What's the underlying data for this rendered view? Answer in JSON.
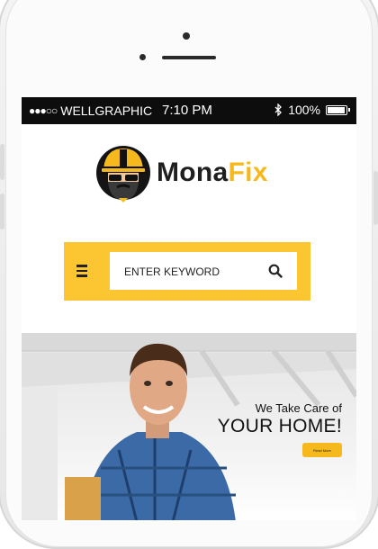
{
  "status_bar": {
    "signal": "●●●○○",
    "carrier": "WELLGRAPHIC",
    "time": "7:10 PM",
    "battery_pct": "100%",
    "battery_level": 1.0,
    "bluetooth_icon": "bluetooth-icon"
  },
  "logo": {
    "part1": "Mona",
    "part2": "Fix",
    "mascot_icon": "worker-mascot-icon"
  },
  "search": {
    "placeholder": "ENTER KEYWORD",
    "menu_icon": "hamburger-menu-icon",
    "search_icon": "search-icon"
  },
  "hero": {
    "line1": "We Take Care of",
    "line2": "YOUR HOME!",
    "button": "Read More"
  },
  "colors": {
    "accent": "#f6b91d",
    "bar": "#fbc631",
    "status_bg": "#0d0d0d"
  }
}
